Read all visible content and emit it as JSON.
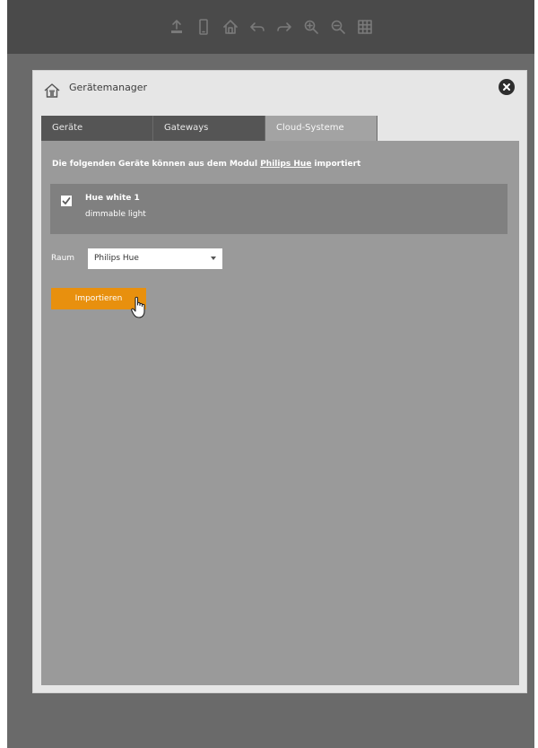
{
  "toolbar": {
    "buttons": [
      {
        "name": "upload-icon"
      },
      {
        "name": "mobile-icon"
      },
      {
        "name": "home-icon"
      },
      {
        "name": "undo-icon"
      },
      {
        "name": "redo-icon"
      },
      {
        "name": "zoom-in-icon"
      },
      {
        "name": "zoom-out-icon"
      },
      {
        "name": "grid-icon"
      }
    ]
  },
  "dialog": {
    "title": "Gerätemanager",
    "icon": "home-icon",
    "close_icon": "close-icon"
  },
  "tabs": [
    {
      "label": "Geräte",
      "active": false
    },
    {
      "label": "Gateways",
      "active": false
    },
    {
      "label": "Cloud-Systeme",
      "active": true
    }
  ],
  "panel": {
    "intro_prefix": "Die folgenden Geräte können aus dem Modul ",
    "intro_link": "Philips Hue",
    "intro_suffix": " importiert",
    "device": {
      "checked": true,
      "name": "Hue white 1",
      "type": "dimmable light"
    },
    "room_label": "Raum",
    "room_value": "Philips Hue",
    "import_label": "Importieren"
  },
  "colors": {
    "accent": "#e8900e",
    "toolbar": "#4a4a4a",
    "panel": "#9a9a9a",
    "tab_inactive": "#555555",
    "tab_active": "#a3a3a3"
  }
}
